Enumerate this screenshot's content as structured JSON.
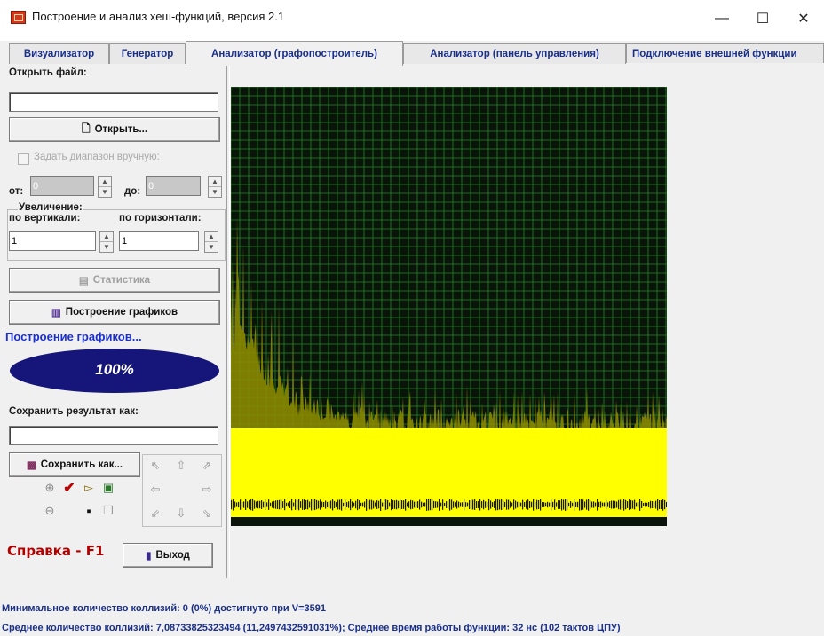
{
  "window": {
    "title": "Построение и анализ хеш-функций, версия 2.1",
    "minimize": "—",
    "maximize": "☐",
    "close": "✕"
  },
  "tabs": [
    {
      "label": "Визуализатор"
    },
    {
      "label": "Генератор"
    },
    {
      "label": "Анализатор (графопостроитель)"
    },
    {
      "label": "Анализатор (панель управления)"
    },
    {
      "label": "Подключение внешней функции"
    }
  ],
  "left": {
    "open_file_label": "Открыть файл:",
    "open_file_value": "",
    "open_button": "Открыть...",
    "manual_range_label": "Задать диапазон вручную:",
    "from_label": "от:",
    "from_value": "0",
    "to_label": "до:",
    "to_value": "0",
    "zoom_label": "Увеличение:",
    "vertical_label": "по вертикали:",
    "horizontal_label": "по горизонтали:",
    "vertical_value": "1",
    "horizontal_value": "1",
    "stats_button": "Статистика",
    "build_button": "Построение графиков",
    "progress_caption": "Построение графиков...",
    "progress_percent": "100%",
    "progress_value": 100,
    "save_label": "Сохранить результат как:",
    "save_value": "",
    "save_button": "Сохранить как...",
    "help": "Справка - F1",
    "exit_button": "Выход"
  },
  "status": {
    "line1": "Минимальное количество коллизий: 0 (0%) достигнуто при V=3591",
    "line2": "Среднее количество коллизий: 7,08733825323494 (11,2497432591031%); Среднее время работы функции: 32 нс (102 тактов ЦПУ)"
  },
  "colors": {
    "graph_background": "#0a140a",
    "grid": "#1f8a1f",
    "series": "#ffff00",
    "series_dark": "#8a8a00",
    "accent_text": "#1a2f8a",
    "progress_fill": "#16167a"
  }
}
